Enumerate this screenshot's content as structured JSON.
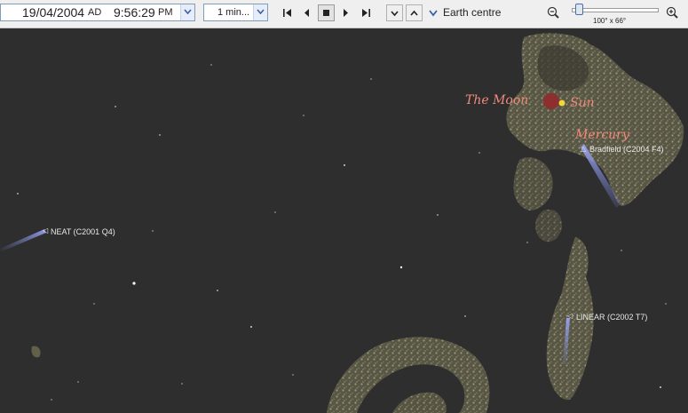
{
  "toolbar": {
    "date": "19/04/2004",
    "era": "AD",
    "time": "9:56:29",
    "ampm": "PM",
    "step": "1 min...",
    "location": "Earth centre",
    "fov": "100° x 66°",
    "zoom_level": 0.05
  },
  "sky": {
    "bodies": {
      "moon": "The Moon",
      "sun": "Sun",
      "mercury": "Mercury"
    },
    "comets": {
      "bradfield": "Bradfield (C2004 F4)",
      "neat": "NEAT (C2001 Q4)",
      "linear": "LINEAR (C2002 T7)"
    }
  },
  "colors": {
    "sky_background": "#2e2e2e",
    "body_label": "#f08a7a",
    "moon": "#8e2e2e",
    "sun": "#f2d63a",
    "comet_tail": "#7a86e0",
    "milky_way": "#8f8a6a"
  }
}
